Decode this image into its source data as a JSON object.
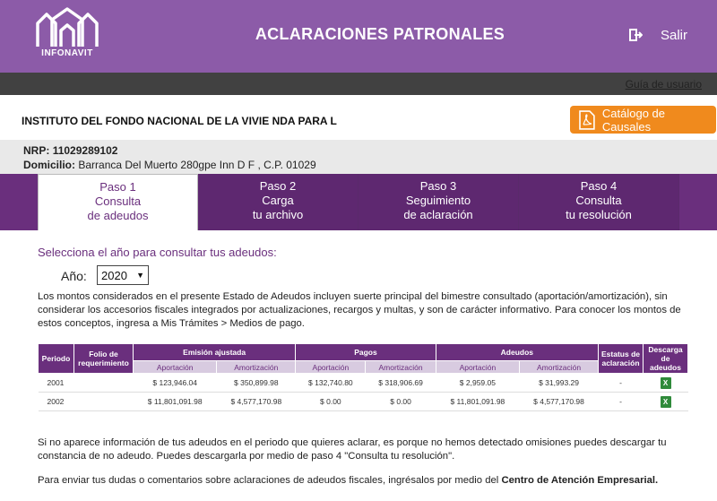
{
  "header": {
    "logo_text": "INFONAVIT",
    "title": "ACLARACIONES PATRONALES",
    "exit_label": "Salir"
  },
  "userbar": {
    "help_link": "Guía de usuario"
  },
  "institution": "INSTITUTO DEL FONDO NACIONAL DE LA VIVIE NDA PARA L",
  "catalog_button": "Catálogo de Causales",
  "employer": {
    "nrp_label": "NRP:",
    "nrp_value": "11029289102",
    "domicilio_label": "Domicilio:",
    "domicilio_value": "Barranca Del Muerto 280gpe Inn D F , C.P. 01029"
  },
  "steps": [
    {
      "title": "Paso 1",
      "line1": "Consulta",
      "line2": "de adeudos"
    },
    {
      "title": "Paso 2",
      "line1": "Carga",
      "line2": "tu archivo"
    },
    {
      "title": "Paso 3",
      "line1": "Seguimiento",
      "line2": "de aclaración"
    },
    {
      "title": "Paso 4",
      "line1": "Consulta",
      "line2": "tu resolución"
    }
  ],
  "year_prompt": "Selecciona el año para consultar tus adeudos:",
  "year_label": "Año:",
  "year_value": "2020",
  "intro_text": "Los montos considerados en el presente Estado de Adeudos incluyen suerte principal del bimestre consultado (aportación/amortización), sin considerar los accesorios fiscales integrados por actualizaciones, recargos y multas, y son de carácter informativo. Para conocer los montos de estos conceptos, ingresa a Mis Trámites > Medios de pago.",
  "table": {
    "headers": {
      "periodo": "Periodo",
      "folio": "Folio de requerimiento",
      "emision": "Emisión ajustada",
      "pagos": "Pagos",
      "adeudos": "Adeudos",
      "estatus": "Estatus de aclaración",
      "descarga": "Descarga de adeudos",
      "aportacion": "Aportación",
      "amortizacion": "Amortización"
    },
    "rows": [
      {
        "periodo": "2001",
        "folio": "",
        "em_aport": "$ 123,946.04",
        "em_amort": "$ 350,899.98",
        "pa_aport": "$ 132,740.80",
        "pa_amort": "$ 318,906.69",
        "ad_aport": "$ 2,959.05",
        "ad_amort": "$ 31,993.29",
        "estatus": "-"
      },
      {
        "periodo": "2002",
        "folio": "",
        "em_aport": "$ 11,801,091.98",
        "em_amort": "$ 4,577,170.98",
        "pa_aport": "$ 0.00",
        "pa_amort": "$ 0.00",
        "ad_aport": "$ 11,801,091.98",
        "ad_amort": "$ 4,577,170.98",
        "estatus": "-"
      }
    ]
  },
  "info_text": "Si no aparece información de tus adeudos en el periodo que quieres aclarar, es porque no hemos detectado omisiones puedes descargar tu constancia de no adeudo. Puedes descargarla por medio de paso 4 \"Consulta tu resolución\".",
  "contact_text": "Para enviar tus dudas o comentarios sobre aclaraciones de adeudos fiscales, ingrésalos por medio del",
  "contact_link": "Centro de Atención Empresarial.",
  "colors": {
    "brand_purple": "#8c5ba8",
    "step_purple": "#6a2f7d",
    "orange": "#f08a1d",
    "excel_green": "#2f8a3a"
  }
}
